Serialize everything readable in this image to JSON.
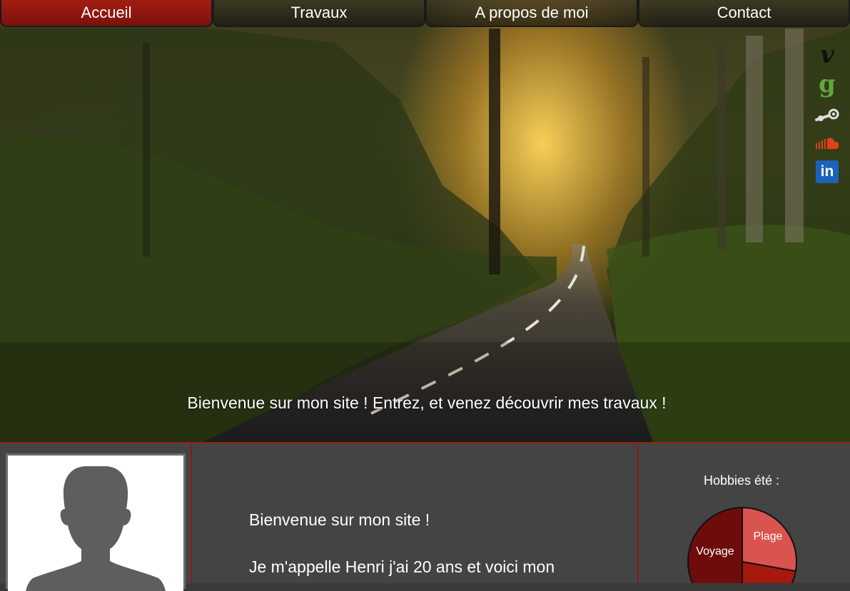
{
  "nav": {
    "tabs": [
      {
        "label": "Accueil",
        "active": true
      },
      {
        "label": "Travaux",
        "active": false
      },
      {
        "label": "A propos de moi",
        "active": false
      },
      {
        "label": "Contact",
        "active": false
      }
    ]
  },
  "hero": {
    "tagline": "Bienvenue sur mon site ! Entrez, et venez découvrir mes travaux !"
  },
  "social": [
    {
      "icon": "vimeo-icon",
      "glyph": "v",
      "color": "#111111"
    },
    {
      "icon": "goodreads-icon",
      "glyph": "g",
      "color": "#5fa83a"
    },
    {
      "icon": "steam-icon",
      "glyph": "",
      "color": "#dddddd"
    },
    {
      "icon": "soundcloud-icon",
      "glyph": "",
      "color": "#e0401a"
    },
    {
      "icon": "linkedin-icon",
      "glyph": "in",
      "color": "#1a63b8"
    }
  ],
  "intro": {
    "line1": "Bienvenue sur mon site !",
    "line2": "Je m'appelle Henri j'ai 20 ans et voici mon"
  },
  "hobbies": {
    "title": "Hobbies été :",
    "slices": [
      {
        "label": "Plage",
        "color": "#d9534f"
      },
      {
        "label": "Voyage",
        "color": "#a8180f"
      },
      {
        "label": "",
        "color": "#6e0c0c"
      }
    ]
  },
  "colors": {
    "accent": "#a31d12",
    "panel": "#444444"
  }
}
